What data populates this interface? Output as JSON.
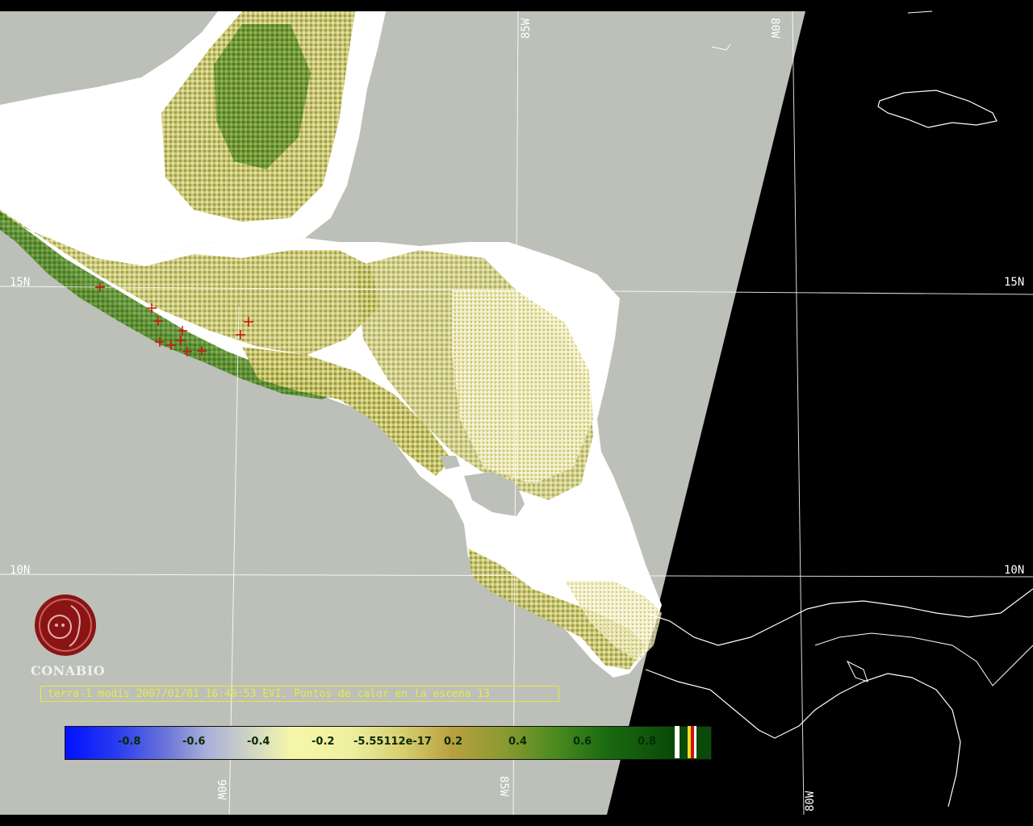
{
  "map": {
    "caption": "terra-1 modis 2007/01/01 16:40:53 EVI, Puntos de calor en la escena 13",
    "grid_labels": {
      "lon_85w_top": "85W",
      "lon_80w_top": "80W",
      "lon_90w_bottom": "90W",
      "lon_85w_bottom": "85W",
      "lon_80w_bottom": "80W",
      "lat_15n_left": "15N",
      "lat_15n_right": "15N",
      "lat_10n_left": "10N",
      "lat_10n_right": "10N"
    },
    "colorbar_labels": [
      "-0.8",
      "-0.6",
      "-0.4",
      "-0.2",
      "-5.55112e-17",
      "0.2",
      "0.4",
      "0.6",
      "0.8"
    ],
    "logo_text": "CONABIO",
    "colors": {
      "ocean": "#bcc0b8",
      "land_white": "#ffffff",
      "vegetation_dark": "#2e6a12",
      "vegetation_mid": "#8a9a30",
      "vegetation_light": "#d8d890",
      "night_side": "#000000",
      "hotspot": "#d01010",
      "caption": "#e8e84a",
      "logo": "#8a1414"
    }
  }
}
